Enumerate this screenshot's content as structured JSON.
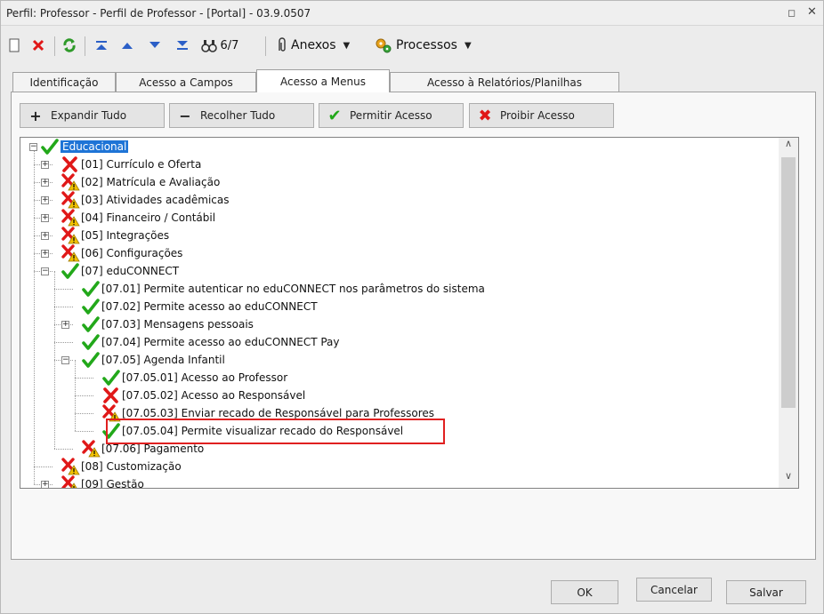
{
  "window": {
    "title": "Perfil: Professor - Perfil de Professor - [Portal] - 03.9.0507",
    "restore_glyph": "◻",
    "close_glyph": "✕"
  },
  "toolbar": {
    "record_counter": "6/7",
    "anexos_label": "Anexos",
    "processos_label": "Processos"
  },
  "tabs": [
    {
      "label": "Identificação"
    },
    {
      "label": "Acesso a Campos"
    },
    {
      "label": "Acesso a Menus"
    },
    {
      "label": "Acesso à Relatórios/Planilhas"
    }
  ],
  "actions": {
    "expand_label": "Expandir Tudo",
    "collapse_label": "Recolher Tudo",
    "allow_label": "Permitir Acesso",
    "deny_label": "Proibir Acesso"
  },
  "tree": [
    {
      "label": "Educacional",
      "status": "allowed",
      "selected": true
    },
    {
      "label": "[01] Currículo e Oferta",
      "status": "denied"
    },
    {
      "label": "[02] Matrícula e Avaliação",
      "status": "partial"
    },
    {
      "label": "[03] Atividades acadêmicas",
      "status": "partial"
    },
    {
      "label": "[04] Financeiro / Contábil",
      "status": "partial"
    },
    {
      "label": "[05] Integrações",
      "status": "partial"
    },
    {
      "label": "[06] Configurações",
      "status": "partial"
    },
    {
      "label": "[07] eduCONNECT",
      "status": "allowed"
    },
    {
      "label": "[07.01] Permite autenticar no eduCONNECT nos parâmetros do sistema",
      "status": "allowed"
    },
    {
      "label": "[07.02] Permite acesso ao eduCONNECT",
      "status": "allowed"
    },
    {
      "label": "[07.03] Mensagens pessoais",
      "status": "allowed"
    },
    {
      "label": "[07.04] Permite acesso ao eduCONNECT Pay",
      "status": "allowed"
    },
    {
      "label": "[07.05] Agenda Infantil",
      "status": "allowed"
    },
    {
      "label": "[07.05.01] Acesso ao Professor",
      "status": "allowed"
    },
    {
      "label": "[07.05.02] Acesso ao Responsável",
      "status": "denied"
    },
    {
      "label": "[07.05.03] Enviar recado de Responsável para Professores",
      "status": "partial"
    },
    {
      "label": "[07.05.04] Permite visualizar recado do Responsável",
      "status": "allowed"
    },
    {
      "label": "[07.06] Pagamento",
      "status": "partial"
    },
    {
      "label": "[08] Customização",
      "status": "partial"
    },
    {
      "label": "[09] Gestão",
      "status": "partial"
    }
  ],
  "footer": {
    "ok_label": "OK",
    "cancel_label": "Cancelar",
    "save_label": "Salvar"
  },
  "colors": {
    "allowed": "#22a81a",
    "denied": "#e01818",
    "warning": "#f2c200",
    "selection": "#1e74d6",
    "highlight_box": "#e02020"
  }
}
